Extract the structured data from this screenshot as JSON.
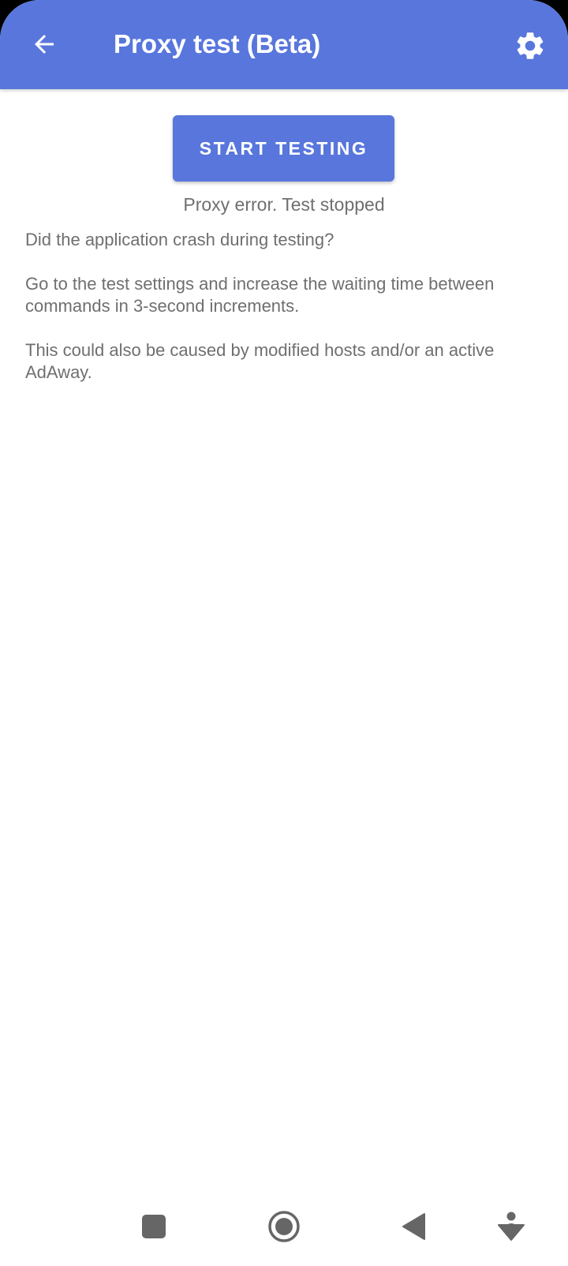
{
  "appbar": {
    "title": "Proxy test (Beta)",
    "back_icon": "arrow-left-icon",
    "settings_icon": "gear-icon",
    "color": "#5876DC"
  },
  "main": {
    "start_button_label": "START TESTING",
    "status_text": "Proxy error. Test stopped",
    "paragraphs": [
      "Did the application crash during testing?",
      "Go to the test settings and increase the waiting time between commands in 3-second increments.",
      "This could also be caused by modified hosts and/or an active AdAway."
    ]
  },
  "navbar": {
    "icons": [
      "square-recents-icon",
      "circle-home-icon",
      "triangle-back-icon",
      "accessibility-down-icon"
    ]
  }
}
